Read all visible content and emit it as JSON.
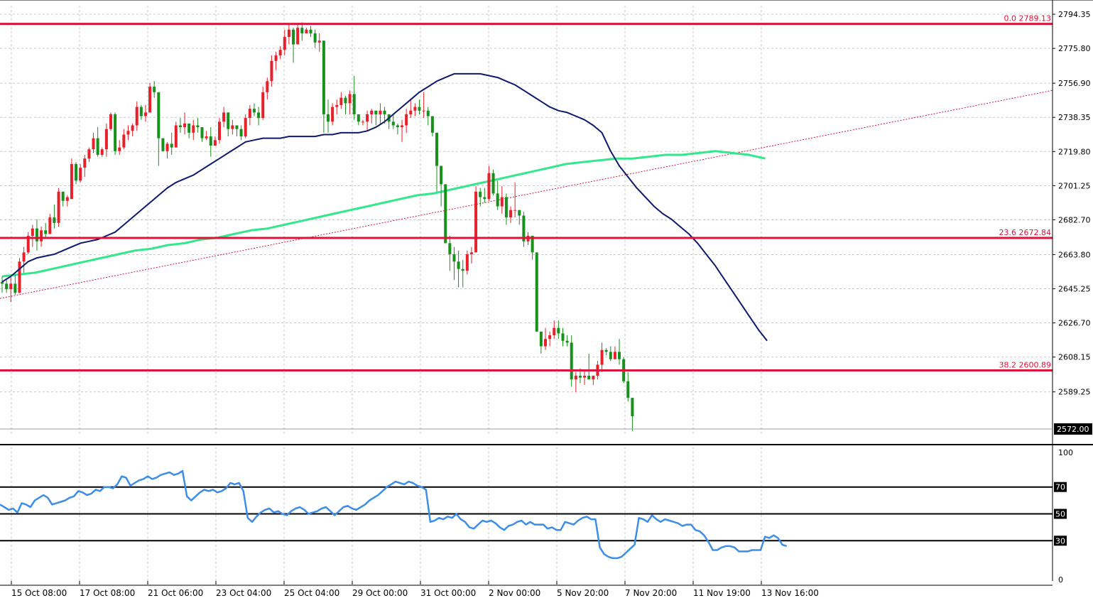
{
  "chart_data": [
    {
      "type": "candlestick",
      "x_tick_labels": [
        "15 Oct 08:00",
        "17 Oct 08:00",
        "21 Oct 06:00",
        "23 Oct 04:00",
        "25 Oct 04:00",
        "29 Oct 00:00",
        "31 Oct 00:00",
        "2 Nov 00:00",
        "5 Nov 20:00",
        "7 Nov 20:00",
        "11 Nov 19:00",
        "13 Nov 16:00"
      ],
      "y_tick_labels": [
        "2794.35",
        "2775.80",
        "2756.90",
        "2738.35",
        "2719.80",
        "2701.25",
        "2682.70",
        "2663.80",
        "2645.25",
        "2626.70",
        "2608.15",
        "2589.25"
      ],
      "ylim": [
        2566,
        2799
      ],
      "current_price": "2572.00",
      "fib_levels": [
        {
          "label": "0.0 2789.13",
          "value": 2789.13
        },
        {
          "label": "23.6 2672.84",
          "value": 2672.84
        },
        {
          "label": "38.2 2600.89",
          "value": 2600.89
        }
      ],
      "colors": {
        "bull": "#e8202a",
        "bear": "#17901c",
        "fib": "#dc143c",
        "ma_fast": "#0d1a6e",
        "ma_slow": "#33e88c",
        "trend": "#dc143c",
        "rsi": "#3d8ee8",
        "grid": "#c8c8c8"
      },
      "candles": [
        [
          2649,
          2652,
          2643,
          2648
        ],
        [
          2648,
          2650,
          2643,
          2645
        ],
        [
          2645,
          2652,
          2638,
          2648
        ],
        [
          2648,
          2653,
          2642,
          2643
        ],
        [
          2643,
          2662,
          2643,
          2660
        ],
        [
          2660,
          2668,
          2654,
          2665
        ],
        [
          2665,
          2676,
          2664,
          2674
        ],
        [
          2674,
          2680,
          2668,
          2678
        ],
        [
          2678,
          2683,
          2666,
          2671
        ],
        [
          2671,
          2679,
          2668,
          2677
        ],
        [
          2677,
          2681,
          2673,
          2675
        ],
        [
          2675,
          2686,
          2675,
          2684
        ],
        [
          2684,
          2691,
          2678,
          2681
        ],
        [
          2681,
          2700,
          2679,
          2698
        ],
        [
          2698,
          2698,
          2690,
          2693
        ],
        [
          2693,
          2696,
          2690,
          2695
        ],
        [
          2694,
          2716,
          2694,
          2713
        ],
        [
          2713,
          2714,
          2702,
          2704
        ],
        [
          2704,
          2713,
          2703,
          2711
        ],
        [
          2711,
          2718,
          2706,
          2716
        ],
        [
          2716,
          2722,
          2714,
          2721
        ],
        [
          2721,
          2730,
          2719,
          2727
        ],
        [
          2727,
          2733,
          2717,
          2718
        ],
        [
          2718,
          2722,
          2717,
          2721
        ],
        [
          2721,
          2735,
          2717,
          2732
        ],
        [
          2732,
          2741,
          2731,
          2740
        ],
        [
          2740,
          2741,
          2718,
          2720
        ],
        [
          2720,
          2726,
          2718,
          2722
        ],
        [
          2722,
          2732,
          2721,
          2729
        ],
        [
          2729,
          2734,
          2726,
          2731
        ],
        [
          2731,
          2735,
          2728,
          2734
        ],
        [
          2734,
          2747,
          2731,
          2744
        ],
        [
          2744,
          2745,
          2737,
          2739
        ],
        [
          2739,
          2745,
          2736,
          2741
        ],
        [
          2741,
          2757,
          2741,
          2755
        ],
        [
          2755,
          2758,
          2749,
          2752
        ],
        [
          2752,
          2752,
          2712,
          2727
        ],
        [
          2727,
          2727,
          2720,
          2720
        ],
        [
          2720,
          2725,
          2716,
          2724
        ],
        [
          2724,
          2730,
          2718,
          2722
        ],
        [
          2722,
          2736,
          2722,
          2734
        ],
        [
          2734,
          2738,
          2730,
          2733
        ],
        [
          2733,
          2741,
          2729,
          2735
        ],
        [
          2735,
          2735,
          2727,
          2730
        ],
        [
          2730,
          2737,
          2726,
          2734
        ],
        [
          2734,
          2738,
          2730,
          2733
        ],
        [
          2733,
          2733,
          2725,
          2727
        ],
        [
          2727,
          2731,
          2726,
          2728
        ],
        [
          2728,
          2733,
          2717,
          2723
        ],
        [
          2723,
          2728,
          2723,
          2726
        ],
        [
          2726,
          2738,
          2724,
          2736
        ],
        [
          2736,
          2744,
          2733,
          2741
        ],
        [
          2741,
          2741,
          2728,
          2732
        ],
        [
          2732,
          2737,
          2729,
          2734
        ],
        [
          2734,
          2734,
          2728,
          2732
        ],
        [
          2732,
          2734,
          2726,
          2728
        ],
        [
          2728,
          2740,
          2727,
          2738
        ],
        [
          2738,
          2745,
          2734,
          2743
        ],
        [
          2743,
          2746,
          2739,
          2741
        ],
        [
          2741,
          2744,
          2734,
          2738
        ],
        [
          2738,
          2755,
          2737,
          2752
        ],
        [
          2752,
          2760,
          2748,
          2758
        ],
        [
          2758,
          2772,
          2755,
          2769
        ],
        [
          2769,
          2774,
          2764,
          2772
        ],
        [
          2772,
          2777,
          2770,
          2775
        ],
        [
          2775,
          2786,
          2772,
          2782
        ],
        [
          2782,
          2789,
          2778,
          2786
        ],
        [
          2786,
          2787,
          2768,
          2778
        ],
        [
          2778,
          2789,
          2778,
          2787
        ],
        [
          2787,
          2790,
          2780,
          2784
        ],
        [
          2784,
          2787,
          2784,
          2786
        ],
        [
          2786,
          2788,
          2782,
          2784
        ],
        [
          2784,
          2786,
          2776,
          2779
        ],
        [
          2779,
          2784,
          2774,
          2780
        ],
        [
          2780,
          2780,
          2730,
          2740
        ],
        [
          2740,
          2748,
          2730,
          2736
        ],
        [
          2736,
          2746,
          2734,
          2744
        ],
        [
          2744,
          2748,
          2740,
          2745
        ],
        [
          2745,
          2752,
          2743,
          2749
        ],
        [
          2749,
          2750,
          2740,
          2746
        ],
        [
          2746,
          2753,
          2740,
          2751
        ],
        [
          2751,
          2761,
          2737,
          2740
        ],
        [
          2740,
          2740,
          2734,
          2736
        ],
        [
          2736,
          2737,
          2734,
          2736
        ],
        [
          2736,
          2742,
          2731,
          2740
        ],
        [
          2740,
          2743,
          2735,
          2742
        ],
        [
          2742,
          2742,
          2734,
          2740
        ],
        [
          2740,
          2746,
          2735,
          2742
        ],
        [
          2742,
          2744,
          2735,
          2740
        ],
        [
          2740,
          2740,
          2732,
          2736
        ],
        [
          2736,
          2740,
          2732,
          2734
        ],
        [
          2734,
          2735,
          2729,
          2733
        ],
        [
          2733,
          2737,
          2725,
          2734
        ],
        [
          2734,
          2743,
          2730,
          2740
        ],
        [
          2740,
          2748,
          2738,
          2742
        ],
        [
          2742,
          2746,
          2739,
          2744
        ],
        [
          2744,
          2748,
          2740,
          2742
        ],
        [
          2742,
          2752,
          2738,
          2742
        ],
        [
          2742,
          2744,
          2734,
          2739
        ],
        [
          2739,
          2739,
          2728,
          2730
        ],
        [
          2730,
          2730,
          2698,
          2712
        ],
        [
          2712,
          2712,
          2690,
          2702
        ],
        [
          2702,
          2702,
          2680,
          2670
        ],
        [
          2670,
          2674,
          2655,
          2664
        ],
        [
          2664,
          2668,
          2650,
          2660
        ],
        [
          2660,
          2666,
          2646,
          2656
        ],
        [
          2656,
          2661,
          2646,
          2655
        ],
        [
          2655,
          2666,
          2653,
          2664
        ],
        [
          2664,
          2668,
          2659,
          2665
        ],
        [
          2665,
          2701,
          2665,
          2698
        ],
        [
          2698,
          2700,
          2690,
          2695
        ],
        [
          2695,
          2700,
          2692,
          2694
        ],
        [
          2694,
          2712,
          2693,
          2708
        ],
        [
          2708,
          2710,
          2696,
          2697
        ],
        [
          2697,
          2704,
          2688,
          2690
        ],
        [
          2690,
          2701,
          2686,
          2695
        ],
        [
          2695,
          2697,
          2680,
          2684
        ],
        [
          2684,
          2690,
          2681,
          2688
        ],
        [
          2688,
          2703,
          2684,
          2688
        ],
        [
          2688,
          2688,
          2680,
          2685
        ],
        [
          2685,
          2687,
          2668,
          2671
        ],
        [
          2671,
          2676,
          2669,
          2674
        ],
        [
          2674,
          2674,
          2661,
          2665
        ],
        [
          2665,
          2665,
          2630,
          2622
        ],
        [
          2622,
          2622,
          2610,
          2614
        ],
        [
          2614,
          2624,
          2612,
          2618
        ],
        [
          2618,
          2622,
          2614,
          2620
        ],
        [
          2620,
          2628,
          2618,
          2624
        ],
        [
          2624,
          2628,
          2618,
          2621
        ],
        [
          2621,
          2624,
          2614,
          2617
        ],
        [
          2617,
          2620,
          2614,
          2616
        ],
        [
          2616,
          2620,
          2592,
          2596
        ],
        [
          2596,
          2600,
          2589,
          2598
        ],
        [
          2598,
          2602,
          2594,
          2597
        ],
        [
          2597,
          2601,
          2593,
          2598
        ],
        [
          2598,
          2610,
          2596,
          2596
        ],
        [
          2596,
          2598,
          2593,
          2598
        ],
        [
          2598,
          2606,
          2596,
          2604
        ],
        [
          2604,
          2616,
          2600,
          2612
        ],
        [
          2612,
          2613,
          2609,
          2611
        ],
        [
          2611,
          2614,
          2606,
          2607
        ],
        [
          2607,
          2614,
          2607,
          2611
        ],
        [
          2611,
          2618,
          2604,
          2607
        ],
        [
          2607,
          2608,
          2594,
          2595
        ],
        [
          2595,
          2600,
          2584,
          2586
        ],
        [
          2586,
          2586,
          2568,
          2576
        ]
      ],
      "series": [
        {
          "values": [
            2649,
            2652,
            2656,
            2660,
            2662,
            2663,
            2664,
            2666,
            2668,
            2670,
            2671,
            2672,
            2674,
            2676,
            2680,
            2684,
            2688,
            2692,
            2696,
            2700,
            2703,
            2705,
            2707,
            2710,
            2713,
            2716,
            2719,
            2722,
            2725,
            2726,
            2727,
            2727,
            2727,
            2728,
            2728,
            2728,
            2728,
            2729,
            2729,
            2730,
            2730,
            2730,
            2731,
            2733,
            2736,
            2740,
            2744,
            2748,
            2752,
            2755,
            2758,
            2760,
            2762,
            2762,
            2762,
            2762,
            2761,
            2760,
            2758,
            2756,
            2753,
            2750,
            2747,
            2744,
            2742,
            2741,
            2739,
            2737,
            2734,
            2730,
            2720,
            2712,
            2706,
            2700,
            2695,
            2690,
            2686,
            2683,
            2679,
            2675,
            2670,
            2664,
            2658,
            2651,
            2644,
            2637,
            2630,
            2623,
            2617
          ]
        },
        {
          "values": [
            2652,
            2653,
            2654,
            2656,
            2658,
            2660,
            2662,
            2664,
            2666,
            2667,
            2669,
            2670,
            2672,
            2673,
            2675,
            2677,
            2678,
            2680,
            2682,
            2684,
            2686,
            2688,
            2690,
            2692,
            2694,
            2696,
            2697,
            2699,
            2701,
            2703,
            2705,
            2707,
            2709,
            2711,
            2713,
            2714,
            2715,
            2716,
            2716,
            2717,
            2718,
            2718,
            2719,
            2720,
            2719,
            2718,
            2716
          ]
        },
        {
          "values": [
            57,
            55,
            53,
            54,
            51,
            58,
            57,
            55,
            60,
            62,
            64,
            62,
            57,
            58,
            59,
            60,
            62,
            63,
            67,
            66,
            64,
            65,
            68,
            67,
            70,
            70,
            69,
            72,
            78,
            77,
            71,
            73,
            75,
            76,
            78,
            76,
            77,
            79,
            80,
            81,
            79,
            80,
            82,
            63,
            60,
            63,
            66,
            68,
            67,
            68,
            66,
            67,
            69,
            73,
            72,
            73,
            67,
            47,
            44,
            48,
            51,
            53,
            54,
            51,
            52,
            50,
            49,
            52,
            54,
            55,
            53,
            50,
            51,
            52,
            54,
            55,
            52,
            49,
            52,
            55,
            56,
            54,
            53,
            55,
            57,
            60,
            62,
            64,
            67,
            70,
            72,
            74,
            73,
            72,
            74,
            73,
            71,
            70,
            68,
            44,
            45,
            47,
            46,
            48,
            47,
            50,
            46,
            44,
            40,
            39,
            42,
            45,
            44,
            45,
            43,
            40,
            38,
            41,
            42,
            44,
            45,
            42,
            44,
            42,
            42,
            42,
            39,
            40,
            38,
            38,
            44,
            43,
            42,
            45,
            47,
            48,
            46,
            46,
            25,
            20,
            18,
            17,
            17,
            18,
            21,
            24,
            27,
            47,
            46,
            44,
            49,
            46,
            44,
            46,
            45,
            44,
            43,
            41,
            42,
            42,
            38,
            37,
            34,
            29,
            23,
            23,
            25,
            26,
            26,
            25,
            22,
            22,
            22,
            23,
            23,
            23,
            33,
            32,
            34,
            32,
            27,
            26
          ]
        }
      ],
      "rsi_levels": [
        {
          "label": "70",
          "value": 70
        },
        {
          "label": "50",
          "value": 50
        },
        {
          "label": "30",
          "value": 30
        }
      ],
      "rsi_tick_labels": [
        "100",
        "0"
      ],
      "rsi_ylim": [
        0,
        100
      ]
    }
  ]
}
